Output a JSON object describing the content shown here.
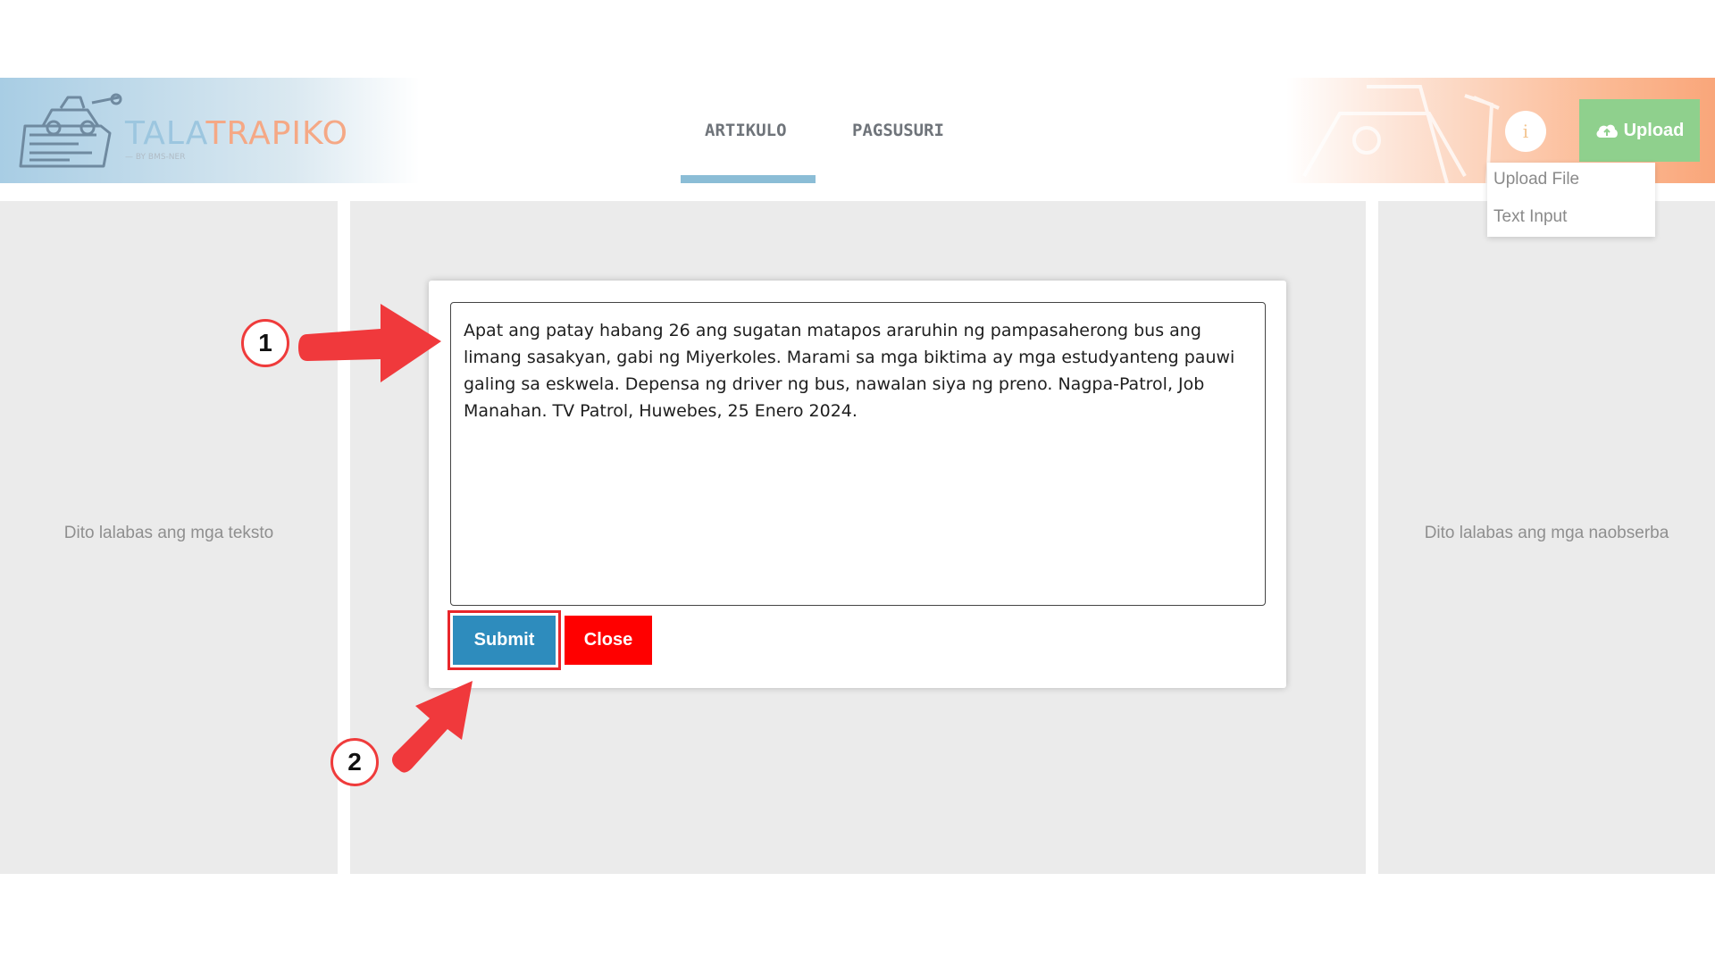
{
  "header": {
    "logo": {
      "text_part1": "TALA",
      "text_part2": "TRAPIKO",
      "subtitle": "— BY BMS-NER"
    },
    "tabs": [
      {
        "label": "ARTIKULO",
        "active": true
      },
      {
        "label": "PAGSUSURI",
        "active": false
      }
    ],
    "info_label": "i",
    "upload_label": "Upload",
    "upload_icon": "cloud-upload-icon"
  },
  "dropdown": {
    "items": [
      "Upload File",
      "Text Input"
    ]
  },
  "panels": {
    "left_placeholder": "Dito lalabas ang mga teksto",
    "right_placeholder": "Dito lalabas ang mga naobserba"
  },
  "modal": {
    "textarea_value": "Apat ang patay habang 26 ang sugatan matapos araruhin ng pampasaherong bus ang limang sasakyan, gabi ng Miyerkoles. Marami sa mga biktima ay mga estudyanteng pauwi galing sa eskwela. Depensa ng driver ng bus, nawalan siya ng preno. Nagpa-Patrol, Job Manahan. TV Patrol, Huwebes, 25 Enero 2024.",
    "submit_label": "Submit",
    "close_label": "Close"
  },
  "annotations": {
    "step1": "1",
    "step2": "2"
  },
  "colors": {
    "tab_underline": "#8bbdd6",
    "upload_button": "#8fd08d",
    "submit_button": "#2e8cbd",
    "close_button": "#ff0000",
    "annotation_red": "#ef3b3b"
  }
}
